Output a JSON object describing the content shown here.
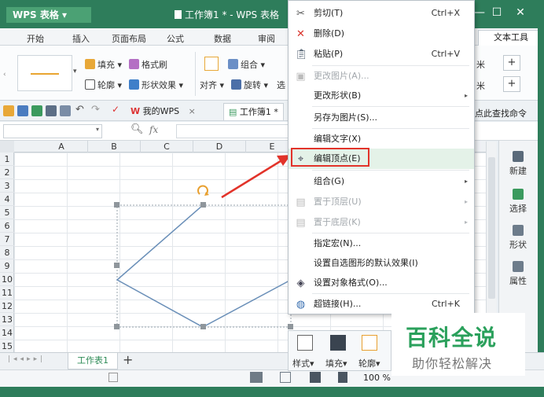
{
  "app": {
    "name": "WPS 表格",
    "doc_title": "工作簿1 * - WPS 表格"
  },
  "ribbon_tabs": [
    "开始",
    "插入",
    "页面布局",
    "公式",
    "数据",
    "审阅"
  ],
  "ribbon_extra_tab": "文本工具",
  "ribbon": {
    "fill": "填充",
    "format_painter": "格式刷",
    "outline": "轮廓",
    "shape_effect": "形状效果",
    "group": "组合",
    "align": "对齐",
    "rotate": "旋转",
    "select_partial": "选",
    "unit1": "米",
    "unit2": "米",
    "plus": "+"
  },
  "quickbar": {
    "mywps": "我的WPS",
    "workbook_tab": "工作簿1 *",
    "find_cmd": "点此查找命令"
  },
  "formula": {
    "fx": "fx"
  },
  "columns": [
    "A",
    "B",
    "C",
    "D",
    "E"
  ],
  "rows": [
    "1",
    "2",
    "3",
    "4",
    "5",
    "6",
    "7",
    "8",
    "9",
    "10",
    "11",
    "12",
    "13",
    "14",
    "15"
  ],
  "sheet_tabs": {
    "sheet1": "工作表1",
    "add": "+"
  },
  "status": {
    "zoom": "100 %"
  },
  "side_panel": [
    "新建",
    "选择",
    "形状",
    "属性"
  ],
  "context_menu": {
    "items": [
      {
        "label": "剪切(T)",
        "shortcut": "Ctrl+X",
        "icon": "scissors-icon",
        "disabled": false
      },
      {
        "label": "删除(D)",
        "shortcut": "",
        "icon": "delete-icon",
        "disabled": false
      },
      {
        "label": "粘贴(P)",
        "shortcut": "Ctrl+V",
        "icon": "paste-icon",
        "disabled": false
      },
      {
        "label": "更改图片(A)...",
        "shortcut": "",
        "icon": "change-picture-icon",
        "disabled": true
      },
      {
        "label": "更改形状(B)",
        "shortcut": "",
        "icon": "",
        "disabled": false
      },
      {
        "label": "另存为图片(S)...",
        "shortcut": "",
        "icon": "",
        "disabled": false
      },
      {
        "label": "编辑文字(X)",
        "shortcut": "",
        "icon": "",
        "disabled": false
      },
      {
        "label": "编辑顶点(E)",
        "shortcut": "",
        "icon": "edit-vertex-icon",
        "disabled": false
      },
      {
        "label": "组合(G)",
        "shortcut": "",
        "icon": "",
        "disabled": false
      },
      {
        "label": "置于顶层(U)",
        "shortcut": "",
        "icon": "bring-front-icon",
        "disabled": true
      },
      {
        "label": "置于底层(K)",
        "shortcut": "",
        "icon": "send-back-icon",
        "disabled": true
      },
      {
        "label": "指定宏(N)...",
        "shortcut": "",
        "icon": "",
        "disabled": false
      },
      {
        "label": "设置自选图形的默认效果(I)",
        "shortcut": "",
        "icon": "",
        "disabled": false
      },
      {
        "label": "设置对象格式(O)...",
        "shortcut": "",
        "icon": "format-object-icon",
        "disabled": false
      },
      {
        "label": "超链接(H)...",
        "shortcut": "Ctrl+K",
        "icon": "hyperlink-icon",
        "disabled": false
      }
    ]
  },
  "float_toolbar": {
    "style": "样式",
    "fill": "填充",
    "outline": "轮廓"
  },
  "watermark": {
    "title": "百科全说",
    "subtitle": "助你轻松解决"
  },
  "colors": {
    "title_green": "#2e7d5b",
    "highlight_red": "#e2332a",
    "shape_line": "#6a8fb8"
  }
}
